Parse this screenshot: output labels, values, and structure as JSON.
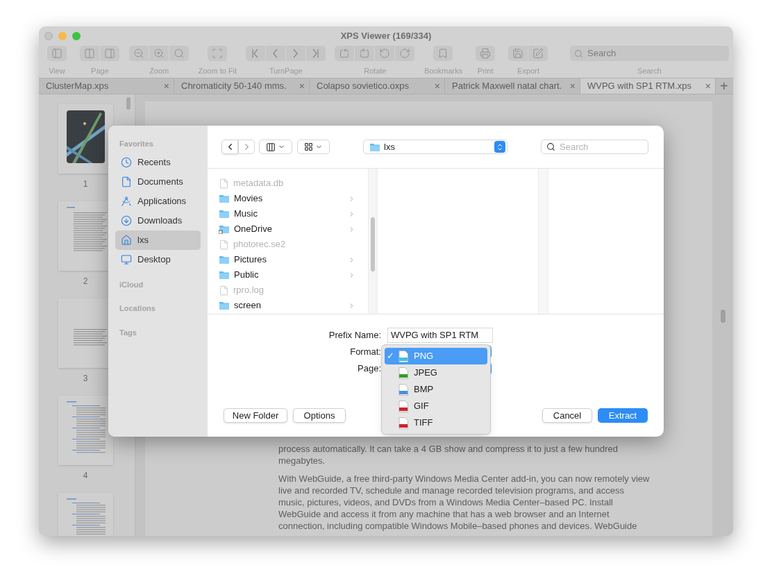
{
  "window": {
    "title": "XPS Viewer (169/334)"
  },
  "toolbar": {
    "groups": [
      {
        "label": "View",
        "buttons": [
          {
            "kind": "sidebar"
          }
        ]
      },
      {
        "label": "Page",
        "buttons": [
          {
            "kind": "two-page"
          },
          {
            "kind": "single-page"
          }
        ]
      },
      {
        "label": "Zoom",
        "buttons": [
          {
            "kind": "zoom-out"
          },
          {
            "kind": "zoom-in"
          },
          {
            "kind": "actual-size"
          }
        ]
      },
      {
        "label": "Zoom to Fit",
        "buttons": [
          {
            "kind": "fit"
          }
        ]
      },
      {
        "label": "TurnPage",
        "buttons": [
          {
            "kind": "first"
          },
          {
            "kind": "prev"
          },
          {
            "kind": "next"
          },
          {
            "kind": "last"
          }
        ]
      },
      {
        "label": "Rotate",
        "buttons": [
          {
            "kind": "rotate-left"
          },
          {
            "kind": "rotate-right"
          },
          {
            "kind": "rotate-page-left"
          },
          {
            "kind": "rotate-page-right"
          }
        ]
      },
      {
        "label": "Bookmarks",
        "buttons": [
          {
            "kind": "bookmark"
          }
        ]
      },
      {
        "label": "Print",
        "buttons": [
          {
            "kind": "print"
          }
        ]
      },
      {
        "label": "Export",
        "buttons": [
          {
            "kind": "save"
          },
          {
            "kind": "edit"
          }
        ]
      }
    ],
    "search": {
      "placeholder": "Search",
      "label": "Search"
    }
  },
  "tabs": [
    {
      "label": "ClusterMap.xps",
      "selected": false,
      "close": "×"
    },
    {
      "label": "Chromaticity 50-140 mms.",
      "selected": false,
      "close": "×"
    },
    {
      "label": "Colapso sovietico.oxps",
      "selected": false,
      "close": "×"
    },
    {
      "label": "Patrick Maxwell natal chart.",
      "selected": false,
      "close": "×"
    },
    {
      "label": "WVPG with SP1 RTM.xps",
      "selected": true,
      "close": "×"
    }
  ],
  "new_tab": "+",
  "thumbnails": [
    {
      "kind": "picture",
      "page": "1"
    },
    {
      "kind": "text",
      "page": "2"
    },
    {
      "kind": "text",
      "page": "3"
    },
    {
      "kind": "toc",
      "page": "4"
    },
    {
      "kind": "toc"
    }
  ],
  "document": {
    "paragraphs": [
      "process automatically. It can take a 4 GB show and compress it to just a few hundred megabytes.",
      "With WebGuide, a free third-party Windows Media Center add-in, you can now remotely view live and recorded TV, schedule and manage recorded television programs, and access music, pictures, videos, and DVDs from a Windows Media Center–based PC. Install WebGuide and access it from any machine that has a web browser and an Internet connection, including compatible Windows Mobile–based phones and devices. WebGuide"
    ]
  },
  "dialog": {
    "sidebar": [
      {
        "title": "Favorites",
        "items": [
          {
            "label": "Recents",
            "kind": "recents",
            "selected": false
          },
          {
            "label": "Documents",
            "kind": "documents",
            "selected": false
          },
          {
            "label": "Applications",
            "kind": "applications",
            "selected": false
          },
          {
            "label": "Downloads",
            "kind": "downloads",
            "selected": false
          },
          {
            "label": "lxs",
            "kind": "home",
            "selected": true
          },
          {
            "label": "Desktop",
            "kind": "desktop",
            "selected": false
          }
        ]
      },
      {
        "title": "iCloud"
      },
      {
        "title": "Locations"
      },
      {
        "title": "Tags"
      }
    ],
    "location": "lxs",
    "search": {
      "placeholder": "Search"
    },
    "files": [
      {
        "name": "metadata.db",
        "kind": "file",
        "disabled": true
      },
      {
        "name": "Movies",
        "kind": "folder",
        "disabled": false
      },
      {
        "name": "Music",
        "kind": "folder",
        "disabled": false
      },
      {
        "name": "OneDrive",
        "kind": "alias",
        "disabled": false
      },
      {
        "name": "photorec.se2",
        "kind": "file",
        "disabled": true
      },
      {
        "name": "Pictures",
        "kind": "folder",
        "disabled": false
      },
      {
        "name": "Public",
        "kind": "folder",
        "disabled": false
      },
      {
        "name": "rpro.log",
        "kind": "file",
        "disabled": true
      },
      {
        "name": "screen",
        "kind": "folder",
        "disabled": false
      }
    ],
    "form": {
      "prefix_label": "Prefix Name:",
      "prefix_value": "WVPG with SP1 RTM",
      "format_label": "Format:",
      "page_label": "Page:"
    },
    "format_menu": [
      {
        "label": "PNG",
        "selected": true,
        "color": "#3fc1e6"
      },
      {
        "label": "JPEG",
        "selected": false,
        "color": "#3a9a2a"
      },
      {
        "label": "BMP",
        "selected": false,
        "color": "#4a8de0"
      },
      {
        "label": "GIF",
        "selected": false,
        "color": "#d0222a"
      },
      {
        "label": "TIFF",
        "selected": false,
        "color": "#d0222a"
      }
    ],
    "check": "✓",
    "buttons": [
      {
        "label": "New Folder",
        "kind": "default"
      },
      {
        "label": "Options",
        "kind": "default"
      },
      {
        "label": "Cancel",
        "kind": "default"
      },
      {
        "label": "Extract",
        "kind": "primary"
      }
    ]
  }
}
